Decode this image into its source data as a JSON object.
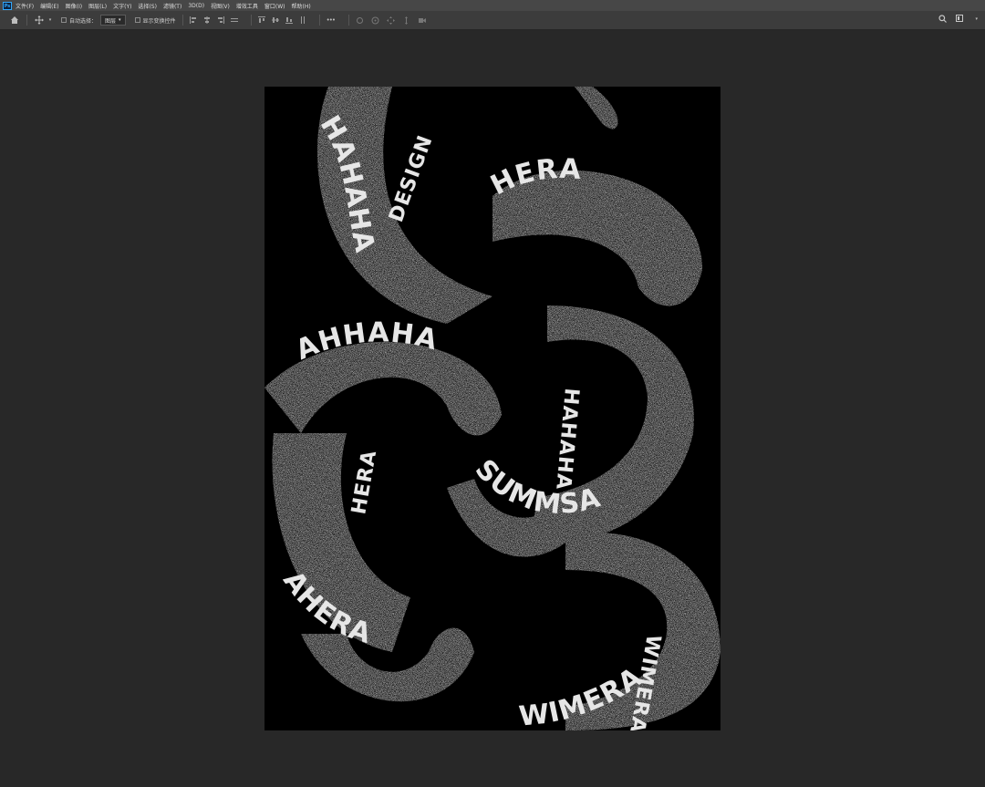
{
  "menu": {
    "app_logo": "Ps",
    "items": [
      "文件(F)",
      "编辑(E)",
      "图像(I)",
      "图层(L)",
      "文字(Y)",
      "选择(S)",
      "滤镜(T)",
      "3D(D)",
      "视图(V)",
      "增效工具",
      "窗口(W)",
      "帮助(H)"
    ]
  },
  "options": {
    "auto_select_label": "自动选择：",
    "auto_select_target": "图层",
    "show_transform_label": "显示变换控件",
    "more_label": "•••"
  },
  "artwork": {
    "words": [
      "HAHAHA",
      "HERA",
      "AHHAHA",
      "SUMMSA",
      "AHERA",
      "WIMERA",
      "DESIGN"
    ]
  }
}
